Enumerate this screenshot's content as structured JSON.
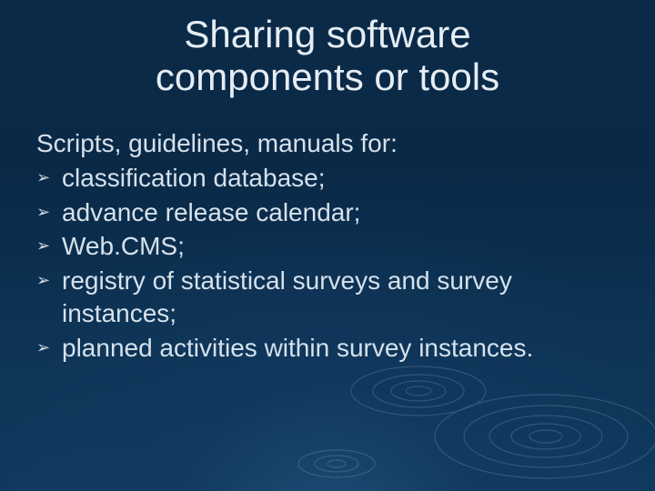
{
  "slide": {
    "title_line1": "Sharing software",
    "title_line2": "components or tools",
    "intro": "Scripts, guidelines, manuals for:",
    "bullet_glyph": "➢",
    "items": [
      "classification database;",
      "advance release calendar;",
      "Web.CMS;",
      "registry of statistical surveys and survey instances;",
      "planned activities within survey instances."
    ]
  }
}
